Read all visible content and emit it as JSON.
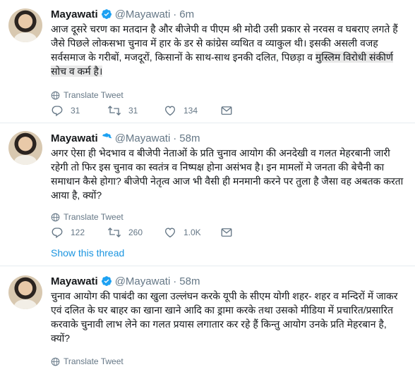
{
  "tweets": [
    {
      "name": "Mayawati",
      "handle": "@Mayawati",
      "dot": "·",
      "time": "6m",
      "text": "आज दूसरे चरण का मतदान है और बीजेपी व पीएम श्री मोदी उसी प्रकार से नरवस व घबराए लगते हैं जैसे पिछले लोकसभा चुनाव में हार के डर से कांग्रेस व्यथित व व्याकुल थी। इसकी असली वजह सर्वसमाज के गरीबों, मजदूरों, किसानों के साथ-साथ इनकी दलित, पिछड़ा व",
      "text_highlight": "मुस्लिम विरोधी संकीर्ण सोच व कर्म है।",
      "translate_label": "Translate Tweet",
      "replies": "31",
      "retweets": "31",
      "likes": "134"
    },
    {
      "name": "Mayawati",
      "handle": "@Mayawati",
      "dot": "·",
      "time": "58m",
      "text": "अगर ऐसा ही भेदभाव व बीजेपी नेताओं के प्रति चुनाव आयोग की अनदेखी व गलत मेहरबानी जारी रहेगी तो फिर इस चुनाव का स्वतंत्र व निष्पक्ष होना असंभव है। इन मामलों मे जनता की बेचैनी का समाधान कैसे होगा? बीजेपी नेतृत्व आज भी वैसी ही मनमानी करने पर तुला है जैसा वह अबतक करता आया है, क्यों?",
      "translate_label": "Translate Tweet",
      "replies": "122",
      "retweets": "260",
      "likes": "1.0K",
      "show_thread": "Show this thread"
    },
    {
      "name": "Mayawati",
      "handle": "@Mayawati",
      "dot": "·",
      "time": "58m",
      "text": "चुनाव आयोग की पाबंदी का खुला उल्लंघन करके यूपी के सीएम योगी शहर- शहर व मन्दिरों में जाकर एवं दलित के घर बाहर का खाना खाने आदि का ड्रामा करके तथा उसको मीडिया में प्रचारित/प्रसारित करवाके चुनावी लाभ लेने का गलत प्रयास लगातार कर रहे हैं किन्तु आयोग उनके प्रति मेहरबान है, क्यों?",
      "translate_label": "Translate Tweet"
    }
  ],
  "colors": {
    "accent": "#1da1f2",
    "secondary_text": "#657786",
    "link": "#1b95e0",
    "divider": "#e6ecf0"
  },
  "icons": {
    "verified": "verified-badge-icon",
    "globe": "globe-icon",
    "reply": "reply-icon",
    "retweet": "retweet-icon",
    "like": "heart-icon",
    "message": "envelope-icon"
  }
}
